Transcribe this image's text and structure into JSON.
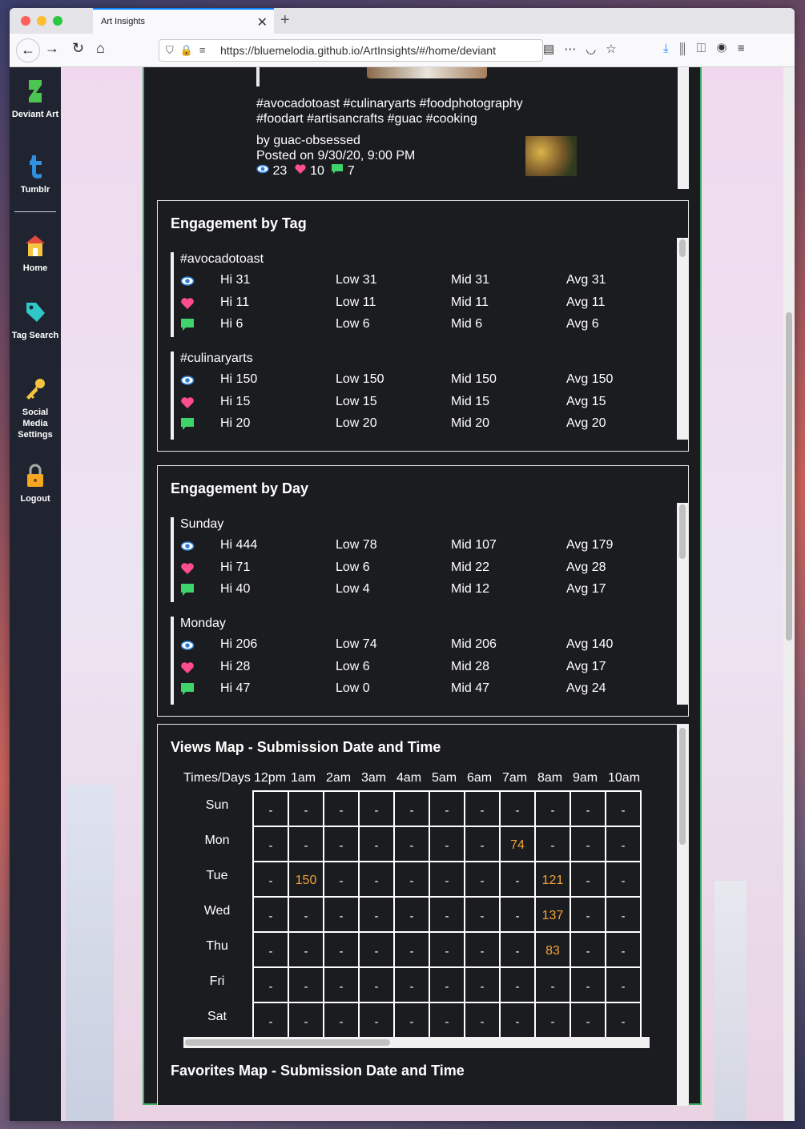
{
  "browser": {
    "tab_title": "Art Insights",
    "tab_close": "✕",
    "new_tab": "+",
    "url": "https://bluemelodia.github.io/ArtInsights/#/home/deviant"
  },
  "sidebar": {
    "items": [
      {
        "label": "Deviant Art",
        "icon": "deviantart-icon"
      },
      {
        "label": "Tumblr",
        "icon": "tumblr-icon"
      },
      {
        "label": "Home",
        "icon": "home-icon"
      },
      {
        "label": "Tag Search",
        "icon": "tag-icon"
      },
      {
        "label": "Social Media Settings",
        "icon": "key-icon"
      },
      {
        "label": "Logout",
        "icon": "lock-icon"
      }
    ]
  },
  "post": {
    "tags_line1": "#avocadotoast #culinaryarts #foodphotography",
    "tags_line2": "#foodart #artisancrafts #guac #cooking",
    "author": "by guac-obsessed",
    "posted": "Posted on 9/30/20, 9:00 PM",
    "views": "23",
    "favorites": "10",
    "comments": "7"
  },
  "engagement_by_tag": {
    "title": "Engagement by Tag",
    "groups": [
      {
        "name": "#avocadotoast",
        "rows": [
          {
            "metric": "views",
            "hi": "Hi 31",
            "low": "Low 31",
            "mid": "Mid 31",
            "avg": "Avg 31"
          },
          {
            "metric": "favorites",
            "hi": "Hi 11",
            "low": "Low 11",
            "mid": "Mid 11",
            "avg": "Avg 11"
          },
          {
            "metric": "comments",
            "hi": "Hi 6",
            "low": "Low 6",
            "mid": "Mid 6",
            "avg": "Avg 6"
          }
        ]
      },
      {
        "name": "#culinaryarts",
        "rows": [
          {
            "metric": "views",
            "hi": "Hi 150",
            "low": "Low 150",
            "mid": "Mid 150",
            "avg": "Avg 150"
          },
          {
            "metric": "favorites",
            "hi": "Hi 15",
            "low": "Low 15",
            "mid": "Mid 15",
            "avg": "Avg 15"
          },
          {
            "metric": "comments",
            "hi": "Hi 20",
            "low": "Low 20",
            "mid": "Mid 20",
            "avg": "Avg 20"
          }
        ]
      }
    ]
  },
  "engagement_by_day": {
    "title": "Engagement by Day",
    "groups": [
      {
        "name": "Sunday",
        "rows": [
          {
            "metric": "views",
            "hi": "Hi 444",
            "low": "Low 78",
            "mid": "Mid 107",
            "avg": "Avg 179"
          },
          {
            "metric": "favorites",
            "hi": "Hi 71",
            "low": "Low 6",
            "mid": "Mid 22",
            "avg": "Avg 28"
          },
          {
            "metric": "comments",
            "hi": "Hi 40",
            "low": "Low 4",
            "mid": "Mid 12",
            "avg": "Avg 17"
          }
        ]
      },
      {
        "name": "Monday",
        "rows": [
          {
            "metric": "views",
            "hi": "Hi 206",
            "low": "Low 74",
            "mid": "Mid 206",
            "avg": "Avg 140"
          },
          {
            "metric": "favorites",
            "hi": "Hi 28",
            "low": "Low 6",
            "mid": "Mid 28",
            "avg": "Avg 17"
          },
          {
            "metric": "comments",
            "hi": "Hi 47",
            "low": "Low 0",
            "mid": "Mid 47",
            "avg": "Avg 24"
          }
        ]
      }
    ]
  },
  "views_map": {
    "title": "Views Map - Submission Date and Time",
    "corner_label": "Times/Days",
    "times": [
      "12pm",
      "1am",
      "2am",
      "3am",
      "4am",
      "5am",
      "6am",
      "7am",
      "8am",
      "9am",
      "10am"
    ],
    "days": [
      "Sun",
      "Mon",
      "Tue",
      "Wed",
      "Thu",
      "Fri",
      "Sat"
    ],
    "cells": [
      [
        "-",
        "-",
        "-",
        "-",
        "-",
        "-",
        "-",
        "-",
        "-",
        "-",
        "-"
      ],
      [
        "-",
        "-",
        "-",
        "-",
        "-",
        "-",
        "-",
        "74",
        "-",
        "-",
        "-"
      ],
      [
        "-",
        "150",
        "-",
        "-",
        "-",
        "-",
        "-",
        "-",
        "121",
        "-",
        "-"
      ],
      [
        "-",
        "-",
        "-",
        "-",
        "-",
        "-",
        "-",
        "-",
        "137",
        "-",
        "-"
      ],
      [
        "-",
        "-",
        "-",
        "-",
        "-",
        "-",
        "-",
        "-",
        "83",
        "-",
        "-"
      ],
      [
        "-",
        "-",
        "-",
        "-",
        "-",
        "-",
        "-",
        "-",
        "-",
        "-",
        "-"
      ],
      [
        "-",
        "-",
        "-",
        "-",
        "-",
        "-",
        "-",
        "-",
        "-",
        "-",
        "-"
      ]
    ]
  },
  "favorites_map": {
    "title": "Favorites Map - Submission Date and Time"
  },
  "colors": {
    "panel_bg": "#1b1c1f",
    "panel_border": "#3fae63",
    "highlight_value": "#f2a23c",
    "sidebar_bg": "#1f2430"
  }
}
